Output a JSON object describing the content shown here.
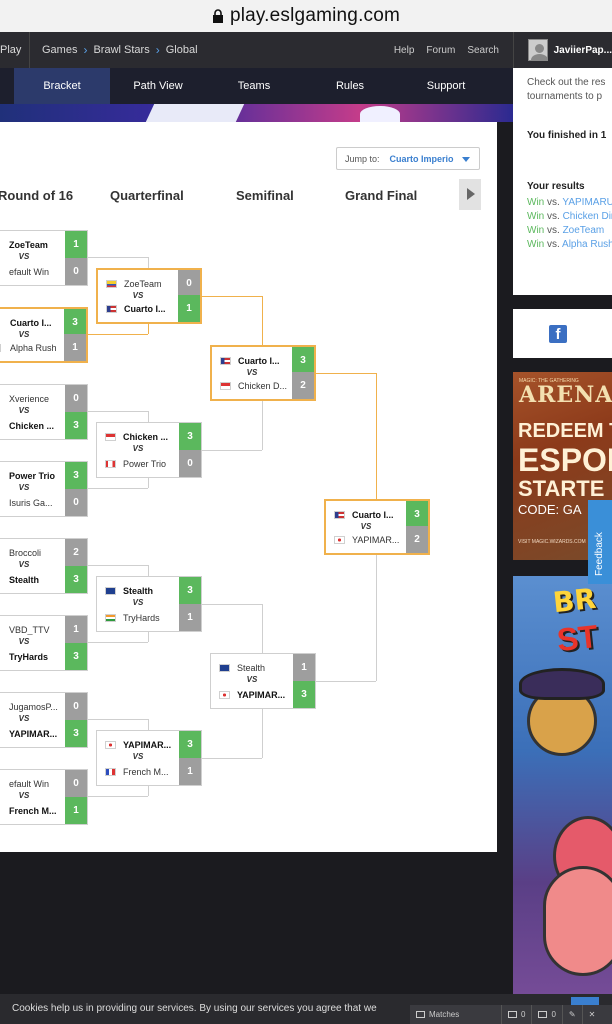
{
  "browser": {
    "url": "play.eslgaming.com"
  },
  "topnav": {
    "brand": "Play",
    "breadcrumb": [
      "Games",
      "Brawl Stars",
      "Global"
    ],
    "links": [
      "Help",
      "Forum",
      "Search"
    ],
    "username": "JaviierPap..."
  },
  "tabs": [
    "Bracket",
    "Path View",
    "Teams",
    "Rules",
    "Support"
  ],
  "bracket": {
    "jump_label": "Jump to:",
    "jump_value": "Cuarto Imperio",
    "rounds": [
      "Round of 16",
      "Quarterfinal",
      "Semifinal",
      "Grand Final"
    ],
    "matches": {
      "r16_1": {
        "a": "ZoeTeam",
        "as": "1",
        "b": "efault Win",
        "bs": "0"
      },
      "r16_2": {
        "a": "Cuarto I...",
        "as": "3",
        "b": "Alpha Rush",
        "bs": "1"
      },
      "r16_3": {
        "a": "Xverience",
        "as": "0",
        "b": "Chicken ...",
        "bs": "3"
      },
      "r16_4": {
        "a": "Power Trio",
        "as": "3",
        "b": "Isuris Ga...",
        "bs": "0"
      },
      "r16_5": {
        "a": "Broccoli",
        "as": "2",
        "b": "Stealth",
        "bs": "3"
      },
      "r16_6": {
        "a": "VBD_TTV",
        "as": "1",
        "b": "TryHards",
        "bs": "3"
      },
      "r16_7": {
        "a": "JugamosP...",
        "as": "0",
        "b": "YAPIMAR...",
        "bs": "3"
      },
      "r16_8": {
        "a": "efault Win",
        "as": "0",
        "b": "French M...",
        "bs": "1"
      },
      "qf_1": {
        "a": "ZoeTeam",
        "as": "0",
        "b": "Cuarto I...",
        "bs": "1"
      },
      "qf_2": {
        "a": "Chicken ...",
        "as": "3",
        "b": "Power Trio",
        "bs": "0"
      },
      "qf_3": {
        "a": "Stealth",
        "as": "3",
        "b": "TryHards",
        "bs": "1"
      },
      "qf_4": {
        "a": "YAPIMAR...",
        "as": "3",
        "b": "French M...",
        "bs": "1"
      },
      "sf_1": {
        "a": "Cuarto I...",
        "as": "3",
        "b": "Chicken D...",
        "bs": "2"
      },
      "sf_2": {
        "a": "Stealth",
        "as": "1",
        "b": "YAPIMAR...",
        "bs": "3"
      },
      "gf": {
        "a": "Cuarto I...",
        "as": "3",
        "b": "YAPIMAR...",
        "bs": "2"
      }
    },
    "vs": "VS"
  },
  "sidebar": {
    "text1": "Check out the res",
    "text2": "tournaments to p",
    "finished": "You finished in 1",
    "results_title": "Your results",
    "results": [
      {
        "result": "Win",
        "vs": "vs.",
        "opponent": "YAPIMARU"
      },
      {
        "result": "Win",
        "vs": "vs.",
        "opponent": "Chicken Din"
      },
      {
        "result": "Win",
        "vs": "vs.",
        "opponent": "ZoeTeam"
      },
      {
        "result": "Win",
        "vs": "vs.",
        "opponent": "Alpha Rush"
      }
    ]
  },
  "ad_arena": {
    "top": "MAGIC: THE GATHERING",
    "brand": "ARENA",
    "line1": "REDEEM T",
    "line2": "ESPOR",
    "line3": "STARTE",
    "code": "CODE: GA",
    "fine": "VISIT MAGIC.WIZARDS.COM"
  },
  "ad_brawl": {
    "logo1": "BR",
    "logo2": "ST"
  },
  "feedback": "Feedback",
  "cookie": {
    "text": "Cookies help us in providing our services. By using our services you agree that we"
  },
  "chat": {
    "label": "Matches",
    "count1": "0",
    "count2": "0"
  },
  "colors": {
    "win": "#5bb85d",
    "loss": "#9e9e9e",
    "highlight": "#f0b14c",
    "link": "#5aa0e6"
  }
}
